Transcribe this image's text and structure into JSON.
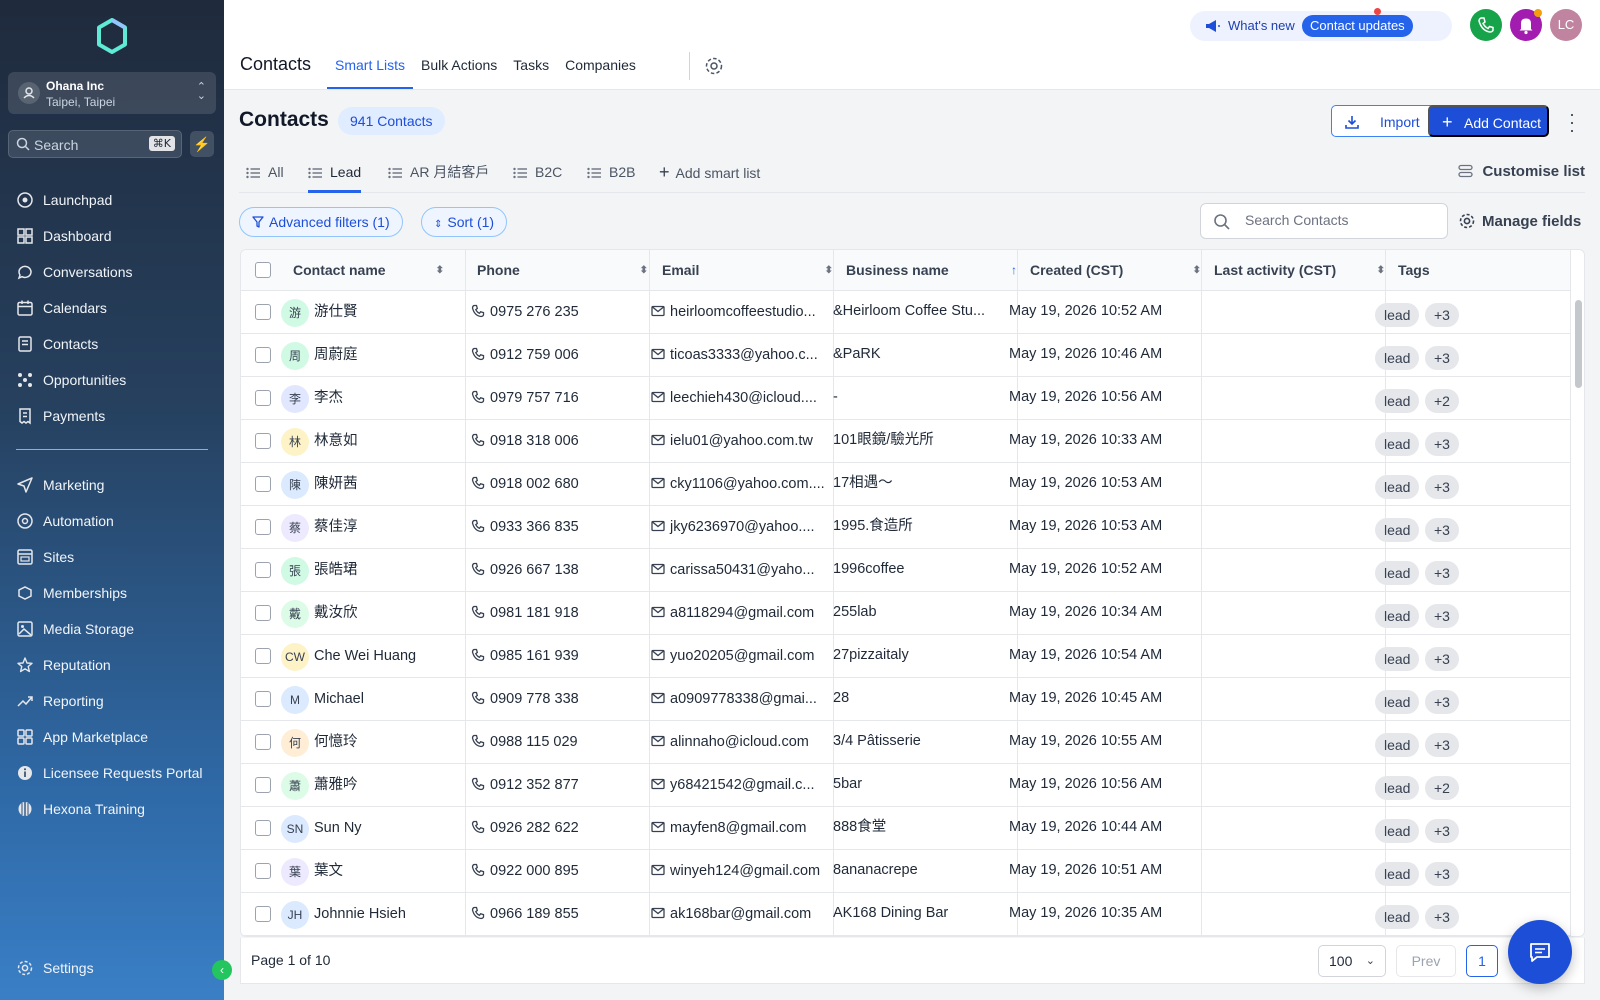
{
  "sidebar": {
    "account": {
      "name": "Ohana Inc",
      "location": "Taipei, Taipei"
    },
    "search": {
      "placeholder": "Search",
      "shortcut": "⌘K"
    },
    "items": [
      {
        "label": "Launchpad",
        "icon": "rocket-icon"
      },
      {
        "label": "Dashboard",
        "icon": "grid-icon"
      },
      {
        "label": "Conversations",
        "icon": "chat-icon"
      },
      {
        "label": "Calendars",
        "icon": "calendar-icon"
      },
      {
        "label": "Contacts",
        "icon": "contacts-icon"
      },
      {
        "label": "Opportunities",
        "icon": "opportunities-icon"
      },
      {
        "label": "Payments",
        "icon": "receipt-icon"
      }
    ],
    "items2": [
      {
        "label": "Marketing",
        "icon": "send-icon"
      },
      {
        "label": "Automation",
        "icon": "automation-icon"
      },
      {
        "label": "Sites",
        "icon": "sites-icon"
      },
      {
        "label": "Memberships",
        "icon": "membership-icon"
      },
      {
        "label": "Media Storage",
        "icon": "image-icon"
      },
      {
        "label": "Reputation",
        "icon": "star-icon"
      },
      {
        "label": "Reporting",
        "icon": "trend-icon"
      },
      {
        "label": "App Marketplace",
        "icon": "apps-icon"
      },
      {
        "label": "Licensee Requests Portal",
        "icon": "info-icon"
      },
      {
        "label": "Hexona Training",
        "icon": "training-icon"
      }
    ],
    "settings": "Settings"
  },
  "topbar": {
    "title": "Contacts",
    "tabs": [
      "Smart Lists",
      "Bulk Actions",
      "Tasks",
      "Companies"
    ],
    "active_tab": "Smart Lists",
    "whats_new": "What's new",
    "contact_updates": "Contact updates",
    "avatar_initials": "LC"
  },
  "header": {
    "title": "Contacts",
    "count": "941 Contacts",
    "import_label": "Import",
    "add_label": "Add Contact"
  },
  "smart_lists": {
    "tabs": [
      "All",
      "Lead",
      "AR 月結客戶",
      "B2C",
      "B2B"
    ],
    "active": "Lead",
    "add_label": "Add smart list",
    "customise": "Customise list"
  },
  "filters": {
    "advanced": "Advanced filters (1)",
    "sort": "Sort (1)",
    "search_placeholder": "Search Contacts",
    "manage_fields": "Manage fields"
  },
  "table": {
    "columns": [
      "Contact name",
      "Phone",
      "Email",
      "Business name",
      "Created (CST)",
      "Last activity (CST)",
      "Tags"
    ],
    "rows": [
      {
        "initials": "游",
        "avatar_color": "#d1fae5",
        "name": "游仕賢",
        "phone": "0975 276 235",
        "email": "heirloomcoffeestudio...",
        "business": "&Heirloom Coffee Stu...",
        "created": "May 19, 2026 10:52 AM",
        "last_activity": "",
        "tag": "lead",
        "more": "+3"
      },
      {
        "initials": "周",
        "avatar_color": "#d1fae5",
        "name": "周蔚庭",
        "phone": "0912 759 006",
        "email": "ticoas3333@yahoo.c...",
        "business": "&PaRK",
        "created": "May 19, 2026 10:46 AM",
        "last_activity": "",
        "tag": "lead",
        "more": "+3"
      },
      {
        "initials": "李",
        "avatar_color": "#e0e7ff",
        "name": "李杰",
        "phone": "0979 757 716",
        "email": "leechieh430@icloud....",
        "business": "-",
        "created": "May 19, 2026 10:56 AM",
        "last_activity": "",
        "tag": "lead",
        "more": "+2"
      },
      {
        "initials": "林",
        "avatar_color": "#fef3c7",
        "name": "林意如",
        "phone": "0918 318 006",
        "email": "ielu01@yahoo.com.tw",
        "business": "101眼鏡/驗光所",
        "created": "May 19, 2026 10:33 AM",
        "last_activity": "",
        "tag": "lead",
        "more": "+3"
      },
      {
        "initials": "陳",
        "avatar_color": "#dbeafe",
        "name": "陳妍茜",
        "phone": "0918 002 680",
        "email": "cky1106@yahoo.com....",
        "business": "17相遇～",
        "created": "May 19, 2026 10:53 AM",
        "last_activity": "",
        "tag": "lead",
        "more": "+3"
      },
      {
        "initials": "蔡",
        "avatar_color": "#ede9fe",
        "name": "蔡佳淳",
        "phone": "0933 366 835",
        "email": "jky6236970@yahoo....",
        "business": "1995.食造所",
        "created": "May 19, 2026 10:53 AM",
        "last_activity": "",
        "tag": "lead",
        "more": "+3"
      },
      {
        "initials": "張",
        "avatar_color": "#d1fae5",
        "name": "張皓珺",
        "phone": "0926 667 138",
        "email": "carissa50431@yaho...",
        "business": "1996coffee",
        "created": "May 19, 2026 10:52 AM",
        "last_activity": "",
        "tag": "lead",
        "more": "+3"
      },
      {
        "initials": "戴",
        "avatar_color": "#dcfce7",
        "name": "戴汝欣",
        "phone": "0981 181 918",
        "email": "a8118294@gmail.com",
        "business": "255lab",
        "created": "May 19, 2026 10:34 AM",
        "last_activity": "",
        "tag": "lead",
        "more": "+3"
      },
      {
        "initials": "CW",
        "avatar_color": "#fef3c7",
        "name": "Che Wei Huang",
        "phone": "0985 161 939",
        "email": "yuo20205@gmail.com",
        "business": "27pizzaitaly",
        "created": "May 19, 2026 10:54 AM",
        "last_activity": "",
        "tag": "lead",
        "more": "+3"
      },
      {
        "initials": "M",
        "avatar_color": "#dbeafe",
        "name": "Michael",
        "phone": "0909 778 338",
        "email": "a0909778338@gmai...",
        "business": "28",
        "created": "May 19, 2026 10:45 AM",
        "last_activity": "",
        "tag": "lead",
        "more": "+3"
      },
      {
        "initials": "何",
        "avatar_color": "#ffedd5",
        "name": "何憶玲",
        "phone": "0988 115 029",
        "email": "alinnaho@icloud.com",
        "business": "3/4 Pâtisserie",
        "created": "May 19, 2026 10:55 AM",
        "last_activity": "",
        "tag": "lead",
        "more": "+3"
      },
      {
        "initials": "蕭",
        "avatar_color": "#dcfce7",
        "name": "蕭雅吟",
        "phone": "0912 352 877",
        "email": "y68421542@gmail.c...",
        "business": "5bar",
        "created": "May 19, 2026 10:56 AM",
        "last_activity": "",
        "tag": "lead",
        "more": "+2"
      },
      {
        "initials": "SN",
        "avatar_color": "#dbeafe",
        "name": "Sun Ny",
        "phone": "0926 282 622",
        "email": "mayfen8@gmail.com",
        "business": "888食堂",
        "created": "May 19, 2026 10:44 AM",
        "last_activity": "",
        "tag": "lead",
        "more": "+3"
      },
      {
        "initials": "葉",
        "avatar_color": "#ede9fe",
        "name": "葉文",
        "phone": "0922 000 895",
        "email": "winyeh124@gmail.com",
        "business": "8ananacrepe",
        "created": "May 19, 2026 10:51 AM",
        "last_activity": "",
        "tag": "lead",
        "more": "+3"
      },
      {
        "initials": "JH",
        "avatar_color": "#dbeafe",
        "name": "Johnnie Hsieh",
        "phone": "0966 189 855",
        "email": "ak168bar@gmail.com",
        "business": "AK168 Dining Bar",
        "created": "May 19, 2026 10:35 AM",
        "last_activity": "",
        "tag": "lead",
        "more": "+3"
      }
    ]
  },
  "pagination": {
    "label": "Page 1 of 10",
    "per_page": "100",
    "prev": "Prev",
    "current": "1"
  },
  "colors": {
    "accent": "#2563eb",
    "sidebar_top": "#1f2a3c",
    "sidebar_bottom": "#3a7fc6"
  }
}
